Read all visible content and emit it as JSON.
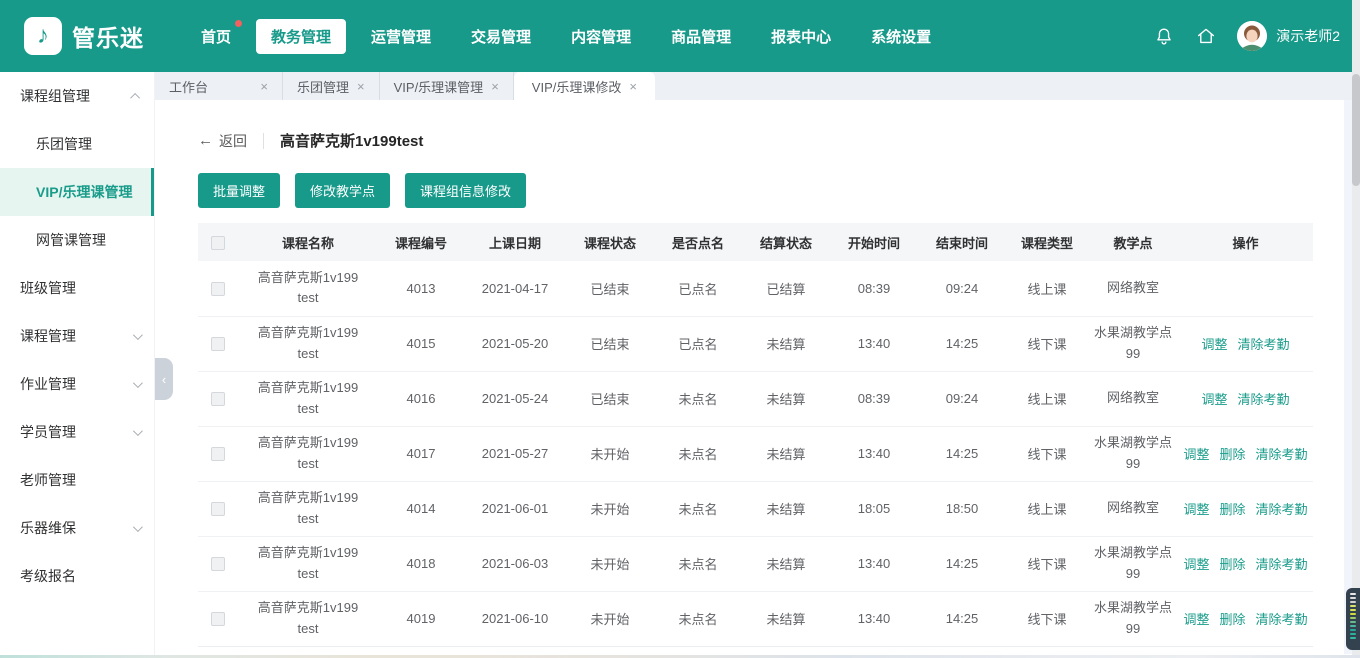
{
  "colors": {
    "accent": "#189a8b",
    "link": "#1a9c8b",
    "badge": "#f2605f"
  },
  "navbar": {
    "logo_text": "管乐迷",
    "items": [
      {
        "label": "首页"
      },
      {
        "label": "教务管理"
      },
      {
        "label": "运营管理"
      },
      {
        "label": "交易管理"
      },
      {
        "label": "内容管理"
      },
      {
        "label": "商品管理"
      },
      {
        "label": "报表中心"
      },
      {
        "label": "系统设置"
      }
    ],
    "user_name": "演示老师2"
  },
  "sidebar": {
    "items": [
      {
        "label": "课程组管理"
      },
      {
        "label": "乐团管理"
      },
      {
        "label": "VIP/乐理课管理"
      },
      {
        "label": "网管课管理"
      },
      {
        "label": "班级管理"
      },
      {
        "label": "课程管理"
      },
      {
        "label": "作业管理"
      },
      {
        "label": "学员管理"
      },
      {
        "label": "老师管理"
      },
      {
        "label": "乐器维保"
      },
      {
        "label": "考级报名"
      }
    ]
  },
  "tabs": {
    "items": [
      {
        "label": "工作台"
      },
      {
        "label": "乐团管理"
      },
      {
        "label": "VIP/乐理课管理"
      },
      {
        "label": "VIP/乐理课修改"
      }
    ]
  },
  "page": {
    "back_label": "返回",
    "title": "高音萨克斯1v199test",
    "buttons": [
      "批量调整",
      "修改教学点",
      "课程组信息修改"
    ]
  },
  "table": {
    "columns": [
      "课程名称",
      "课程编号",
      "上课日期",
      "课程状态",
      "是否点名",
      "结算状态",
      "开始时间",
      "结束时间",
      "课程类型",
      "教学点",
      "操作"
    ],
    "rows": [
      {
        "name": "高音萨克斯1v199test",
        "code": "4013",
        "date": "2021-04-17",
        "status": "已结束",
        "attendance": "已点名",
        "settlement": "已结算",
        "start": "08:39",
        "end": "09:24",
        "type": "线上课",
        "location": "网络教室",
        "actions": []
      },
      {
        "name": "高音萨克斯1v199test",
        "code": "4015",
        "date": "2021-05-20",
        "status": "已结束",
        "attendance": "已点名",
        "settlement": "未结算",
        "start": "13:40",
        "end": "14:25",
        "type": "线下课",
        "location": "水果湖教学点99",
        "actions": [
          "调整",
          "清除考勤"
        ]
      },
      {
        "name": "高音萨克斯1v199test",
        "code": "4016",
        "date": "2021-05-24",
        "status": "已结束",
        "attendance": "未点名",
        "settlement": "未结算",
        "start": "08:39",
        "end": "09:24",
        "type": "线上课",
        "location": "网络教室",
        "actions": [
          "调整",
          "清除考勤"
        ]
      },
      {
        "name": "高音萨克斯1v199test",
        "code": "4017",
        "date": "2021-05-27",
        "status": "未开始",
        "attendance": "未点名",
        "settlement": "未结算",
        "start": "13:40",
        "end": "14:25",
        "type": "线下课",
        "location": "水果湖教学点99",
        "actions": [
          "调整",
          "删除",
          "清除考勤"
        ]
      },
      {
        "name": "高音萨克斯1v199test",
        "code": "4014",
        "date": "2021-06-01",
        "status": "未开始",
        "attendance": "未点名",
        "settlement": "未结算",
        "start": "18:05",
        "end": "18:50",
        "type": "线上课",
        "location": "网络教室",
        "actions": [
          "调整",
          "删除",
          "清除考勤"
        ]
      },
      {
        "name": "高音萨克斯1v199test",
        "code": "4018",
        "date": "2021-06-03",
        "status": "未开始",
        "attendance": "未点名",
        "settlement": "未结算",
        "start": "13:40",
        "end": "14:25",
        "type": "线下课",
        "location": "水果湖教学点99",
        "actions": [
          "调整",
          "删除",
          "清除考勤"
        ]
      },
      {
        "name": "高音萨克斯1v199test",
        "code": "4019",
        "date": "2021-06-10",
        "status": "未开始",
        "attendance": "未点名",
        "settlement": "未结算",
        "start": "13:40",
        "end": "14:25",
        "type": "线下课",
        "location": "水果湖教学点99",
        "actions": [
          "调整",
          "删除",
          "清除考勤"
        ]
      }
    ]
  }
}
